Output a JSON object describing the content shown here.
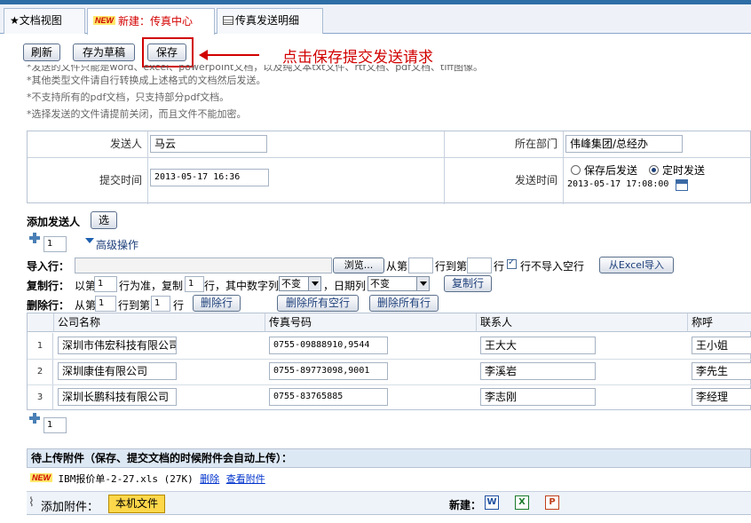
{
  "tabs": [
    {
      "icon": "star-icon",
      "label": "★文档视图"
    },
    {
      "badge": "NEW",
      "label": "新建：传真中心"
    },
    {
      "icon": "table-icon",
      "label": "传真发送明细"
    }
  ],
  "toolbar": {
    "refresh": "刷新",
    "save_draft": "存为草稿",
    "save": "保存"
  },
  "callout": "点击保存提交发送请求",
  "notes": [
    "*发送的文件只能是word、excel、powerpoint文档，以及纯文本txt文件、rtf文档、pdf文档、tiff图像。",
    "*其他类型文件请自行转换成上述格式的文档然后发送。",
    "*不支持所有的pdf文档，只支持部分pdf文档。",
    "*选择发送的文件请提前关闭，而且文件不能加密。"
  ],
  "form": {
    "sender_label": "发送人",
    "sender_value": "马云",
    "dept_label": "所在部门",
    "dept_value": "伟峰集团/总经办",
    "submit_time_label": "提交时间",
    "submit_time_value": "2013-05-17 16:36",
    "send_time_label": "发送时间",
    "send_opt_after_save": "保存后发送",
    "send_opt_scheduled": "定时发送",
    "scheduled_time": "2013-05-17 17:08:00"
  },
  "recipients": {
    "add_label": "添加发送人",
    "select_btn": "选",
    "count_top": "1",
    "advanced": "高级操作",
    "import_label": "导入行：",
    "browse_btn": "浏览...",
    "from_text": "从第",
    "to_text": "行到第",
    "row_text": "行",
    "skip_empty": "行不导入空行",
    "excel_import_btn": "从Excel导入",
    "copy_label": "复制行：",
    "copy_from": "以第",
    "copy_row_val": "1",
    "copy_base": "行为准，复制",
    "copy_count": "1",
    "copy_numcol": "行，其中数字列",
    "copy_num_opt": "不变",
    "copy_datecol": "，日期列",
    "copy_date_opt": "不变",
    "copy_btn": "复制行",
    "delete_label": "删除行：",
    "delete_from": "从第",
    "delete_from_val": "1",
    "delete_to": "行到第",
    "delete_to_val": "1",
    "delete_row": "行",
    "delete_btn": "删除行",
    "delete_empty_btn": "删除所有空行",
    "delete_all_btn": "删除所有行",
    "columns": [
      "公司名称",
      "传真号码",
      "联系人",
      "称呼"
    ],
    "rows": [
      {
        "no": "1",
        "company": "深圳市伟宏科技有限公司",
        "fax": "0755-09888910,9544",
        "contact": "王大大",
        "title": "王小姐"
      },
      {
        "no": "2",
        "company": "深圳康佳有限公司",
        "fax": "0755-89773098,9001",
        "contact": "李溪岩",
        "title": "李先生"
      },
      {
        "no": "3",
        "company": "深圳长鹏科技有限公司",
        "fax": "0755-83765885",
        "contact": "李志刚",
        "title": "李经理"
      }
    ],
    "count_bottom": "1"
  },
  "attachments": {
    "header": "待上传附件（保存、提交文档的时候附件会自动上传）：",
    "badge": "NEW",
    "file": "IBM报价单-2-27.xls (27K)",
    "delete": "删除",
    "view": "查看附件",
    "add_label": "添加附件：",
    "local_file_btn": "本机文件",
    "new_label": "新建：",
    "new_types": [
      "W",
      "X",
      "P"
    ]
  },
  "colors": {
    "accent": "#2e6ea6",
    "highlight": "#d10000",
    "link": "#0033cc"
  }
}
